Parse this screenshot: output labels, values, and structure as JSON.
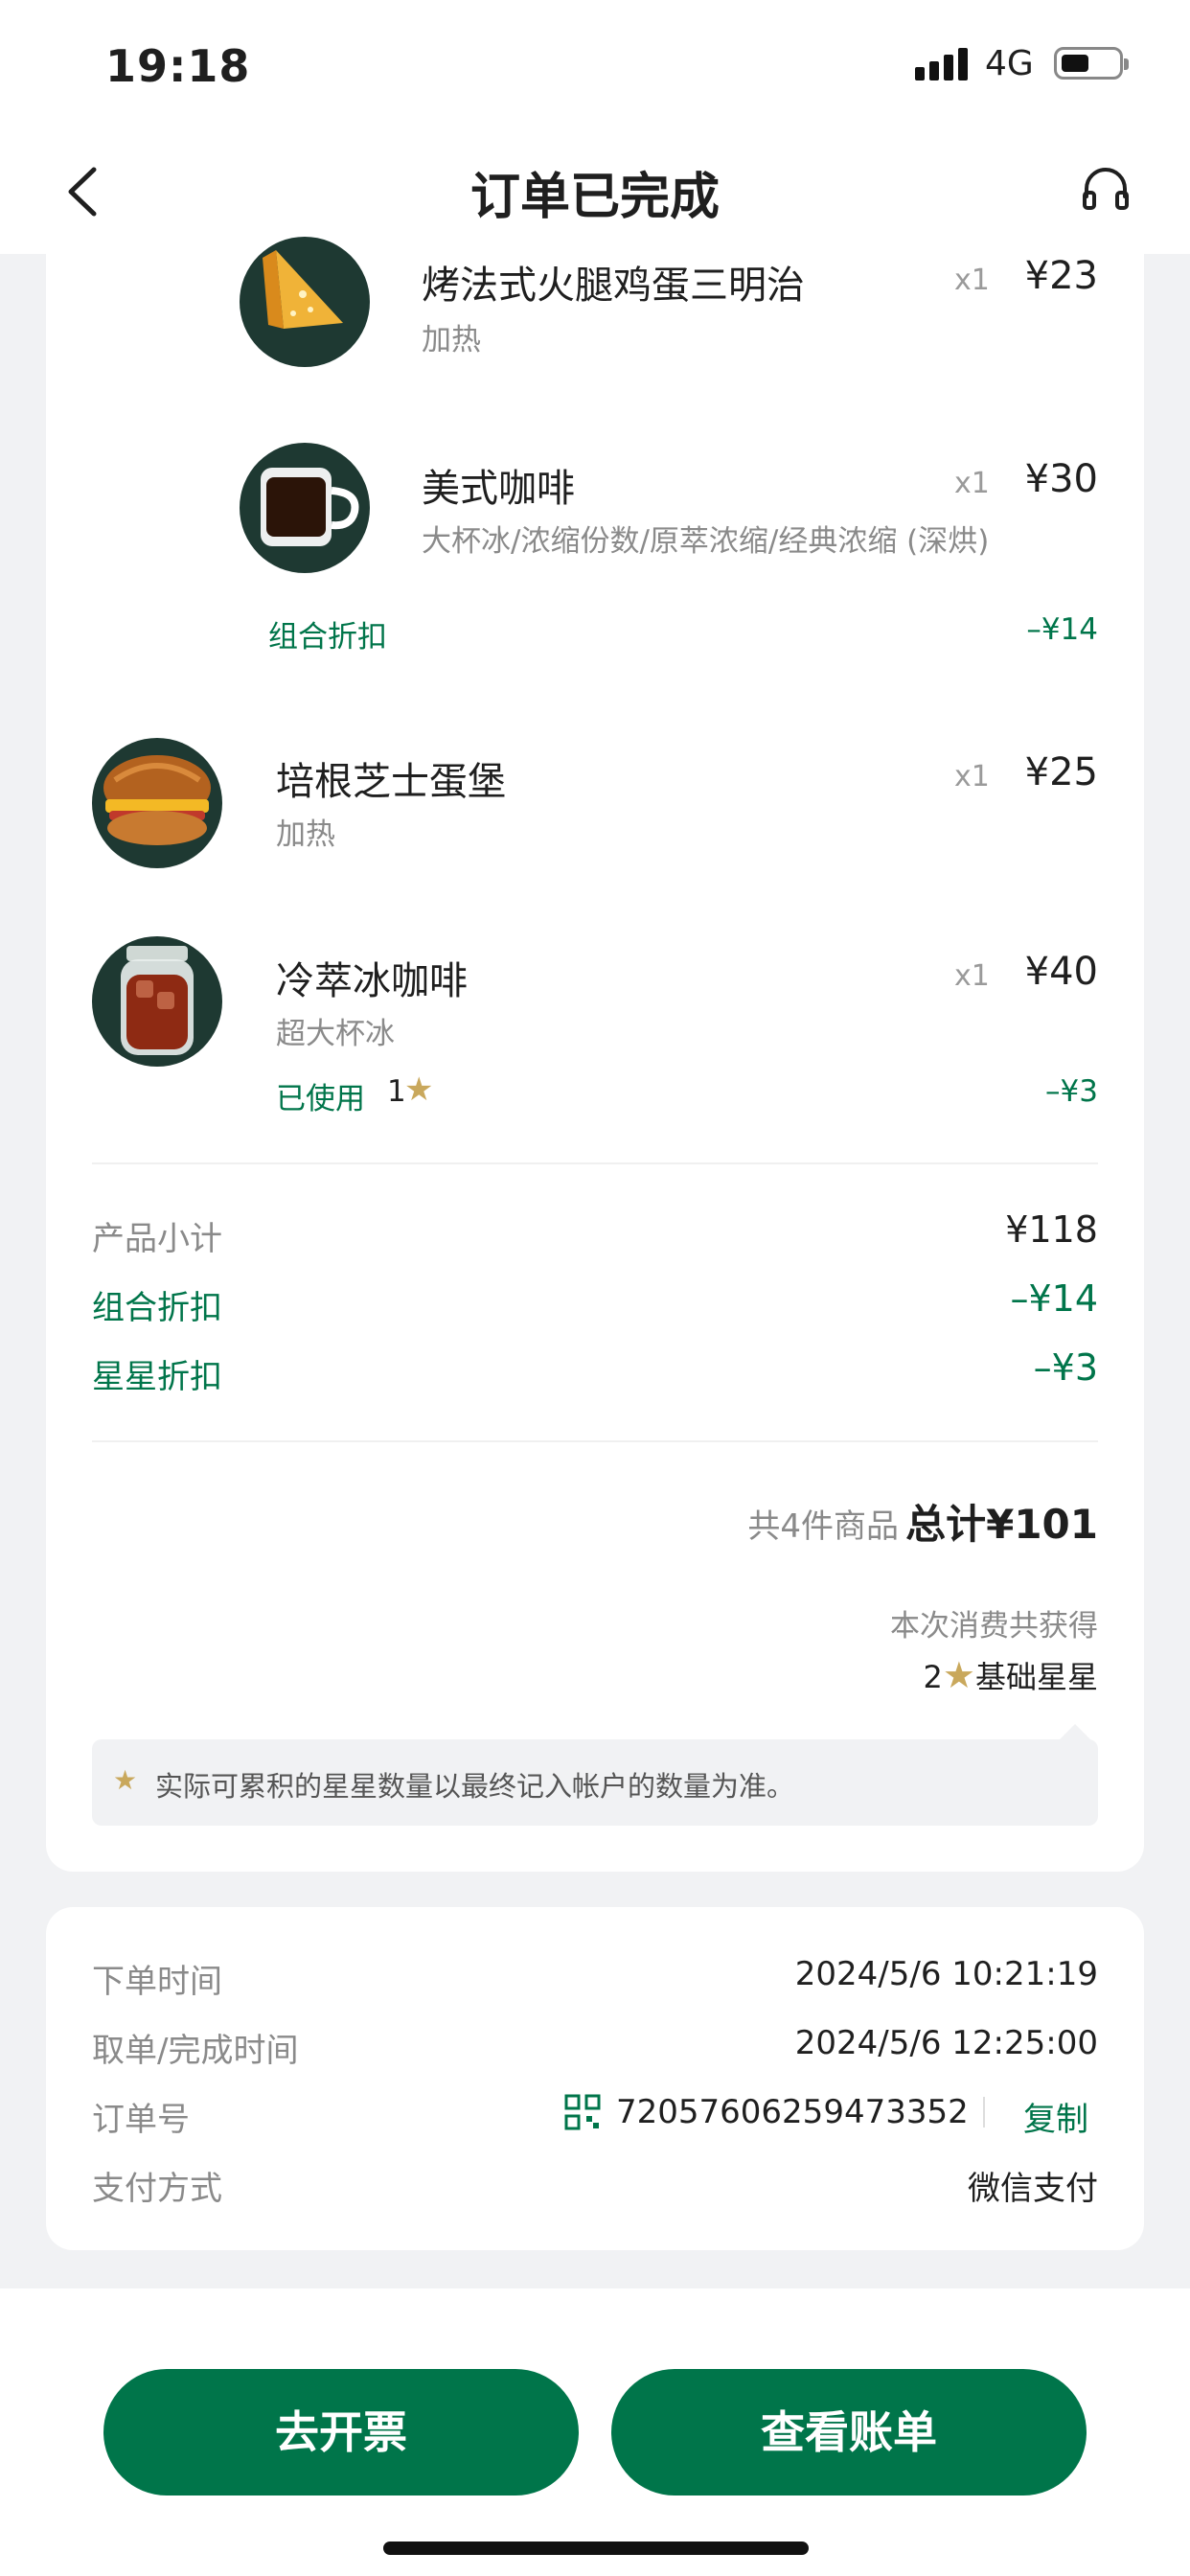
{
  "status_bar": {
    "time": "19:18",
    "network": "4G"
  },
  "nav": {
    "title": "订单已完成"
  },
  "items": [
    {
      "name": "烤法式火腿鸡蛋三明治",
      "spec": "加热",
      "qty": "x1",
      "price": "¥23"
    },
    {
      "name": "美式咖啡",
      "spec": "大杯冰/浓缩份数/原萃浓缩/经典浓缩 (深烘)",
      "qty": "x1",
      "price": "¥30"
    },
    {
      "name": "培根芝士蛋堡",
      "spec": "加热",
      "qty": "x1",
      "price": "¥25"
    },
    {
      "name": "冷萃冰咖啡",
      "spec": "超大杯冰",
      "qty": "x1",
      "price": "¥40"
    }
  ],
  "combo_discount": {
    "label": "组合折扣",
    "value": "–¥14"
  },
  "star_used": {
    "label": "已使用",
    "count": "1",
    "value": "–¥3"
  },
  "summary": {
    "subtotal_label": "产品小计",
    "subtotal": "¥118",
    "combo_label": "组合折扣",
    "combo": "–¥14",
    "star_label": "星星折扣",
    "star": "–¥3"
  },
  "total": {
    "count_text": "共4件商品",
    "total_text": "总计¥101",
    "earned_label": "本次消费共获得",
    "earned_count": "2",
    "earned_type": "基础星星"
  },
  "note": "实际可累积的星星数量以最终记入帐户的数量为准。",
  "order_info": {
    "order_time_label": "下单时间",
    "order_time": "2024/5/6 10:21:19",
    "pickup_time_label": "取单/完成时间",
    "pickup_time": "2024/5/6 12:25:00",
    "order_no_label": "订单号",
    "order_no": "72057606259473352",
    "copy_label": "复制",
    "payment_label": "支付方式",
    "payment": "微信支付"
  },
  "buttons": {
    "invoice": "去开票",
    "bill": "查看账单"
  },
  "colors": {
    "brand_green": "#00754a",
    "star_gold": "#c9a85c",
    "dark_green": "#1e3932"
  }
}
